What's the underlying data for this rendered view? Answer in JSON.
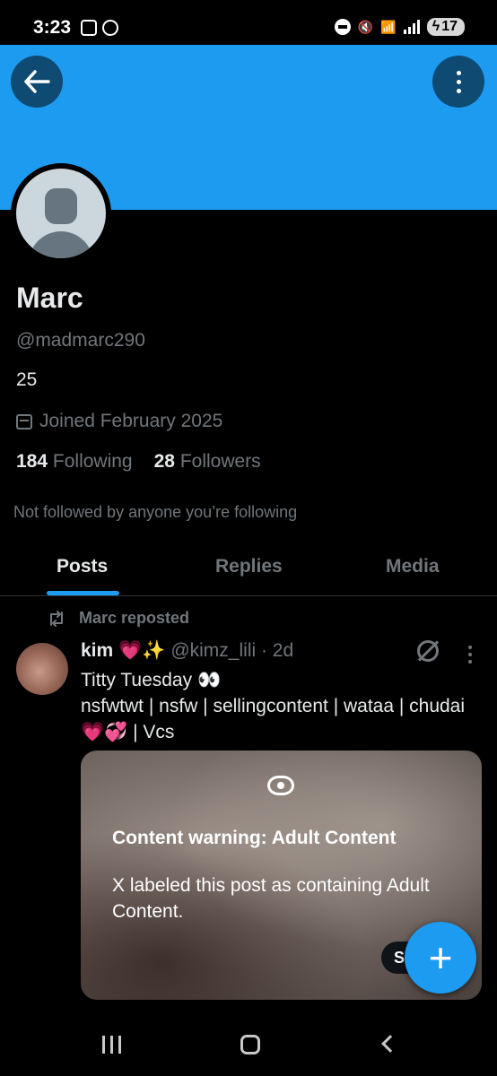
{
  "status_bar": {
    "time": "3:23",
    "battery": "17"
  },
  "profile": {
    "display_name": "Marc",
    "handle": "@madmarc290",
    "bio": "25",
    "joined": "Joined February 2025",
    "following_count": "184",
    "following_label": "Following",
    "followers_count": "28",
    "followers_label": "Followers",
    "not_followed_text": "Not followed by anyone you’re following"
  },
  "tabs": [
    {
      "label": "Posts",
      "active": true
    },
    {
      "label": "Replies",
      "active": false
    },
    {
      "label": "Media",
      "active": false
    }
  ],
  "post": {
    "repost_text": "Marc reposted",
    "author": "kim 💗✨",
    "meta": "@kimz_lili · 2d",
    "text_line1": "Titty Tuesday 👀",
    "text_line2": "nsfwtwt | nsfw | sellingcontent | wataa | chudai 💗💞 | Vcs",
    "content_warning_title": "Content warning: Adult Content",
    "content_warning_body": "X labeled this post as containing Adult Content.",
    "show_button": "S"
  },
  "fab": {
    "label": "+"
  },
  "icons": {
    "back": "back-arrow-icon",
    "more": "more-vertical-icon",
    "calendar": "calendar-icon",
    "repost": "repost-icon",
    "grok": "grok-icon",
    "eye": "eye-icon"
  },
  "colors": {
    "accent": "#1d9bf0",
    "background": "#000000",
    "secondary_text": "#71767b"
  }
}
